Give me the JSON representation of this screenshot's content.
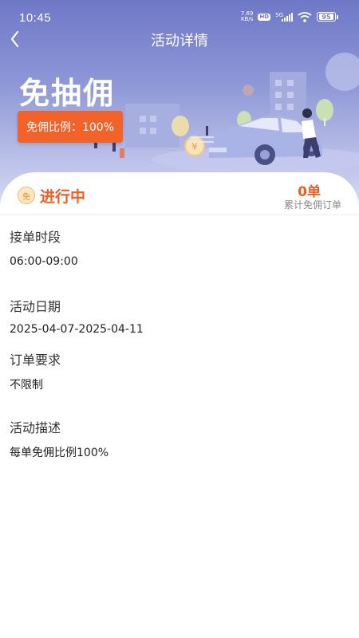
{
  "status_bar": {
    "time": "10:45",
    "net_speed": "7.69",
    "net_unit": "KB/s",
    "hd": "HD",
    "network": "5G",
    "battery": "95"
  },
  "nav": {
    "title": "活动详情"
  },
  "hero": {
    "title": "免抽佣",
    "ratio_badge": "免佣比例：100%"
  },
  "summary": {
    "status_icon_text": "免",
    "status": "进行中",
    "count_value": "0单",
    "count_label": "累计免佣订单"
  },
  "details": {
    "order_period_label": "接单时段",
    "order_period_value": "06:00-09:00",
    "date_label": "活动日期",
    "date_value": "2025-04-07-2025-04-11",
    "requirement_label": "订单要求",
    "requirement_value": "不限制",
    "description_label": "活动描述",
    "description_value": "每单免佣比例100%"
  },
  "colors": {
    "accent": "#ee5e23",
    "badge": "#f2632a",
    "hero_top": "#6e78c6"
  }
}
